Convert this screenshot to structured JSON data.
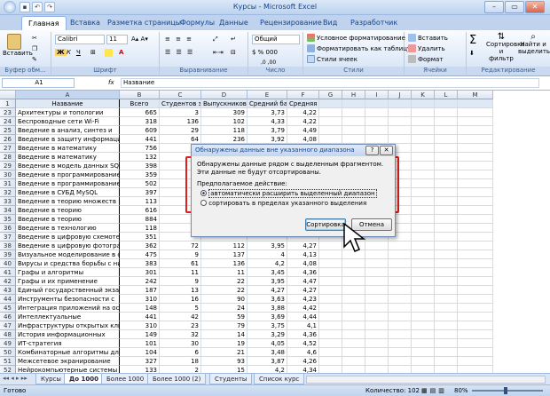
{
  "window": {
    "title": "Курсы - Microsoft Excel"
  },
  "tabs": [
    "Главная",
    "Вставка",
    "Разметка страницы",
    "Формулы",
    "Данные",
    "Рецензирование",
    "Вид",
    "Разработчик"
  ],
  "ribbon": {
    "paste": "Вставить",
    "clipboard": "Буфер обм...",
    "font_name": "Calibri",
    "font_size": "11",
    "font_group": "Шрифт",
    "align_group": "Выравнивание",
    "number_format": "Общий",
    "number_group": "Число",
    "cond_format": "Условное форматирование",
    "format_table": "Форматировать как таблицу",
    "cell_styles": "Стили ячеек",
    "styles_group": "Стили",
    "insert": "Вставить",
    "delete": "Удалить",
    "format": "Формат",
    "cells_group": "Ячейки",
    "sort_filter": "Сортировка и фильтр",
    "find_select": "Найти и выделить",
    "editing_group": "Редактирование"
  },
  "formula_bar": {
    "name_box": "A1",
    "fx": "fx",
    "value": "Название"
  },
  "columns": [
    "A",
    "B",
    "C",
    "D",
    "E",
    "F",
    "G",
    "H",
    "I",
    "J",
    "K",
    "L",
    "M"
  ],
  "header_row": {
    "num": "1",
    "a": "Название",
    "b": "Всего",
    "c": "Студентов за",
    "d": "Выпускников",
    "e": "Средний балл",
    "f": "Средняя"
  },
  "rows": [
    {
      "n": "23",
      "a": "Архитектуры и топологии",
      "b": "665",
      "c": "3",
      "d": "309",
      "e": "3,73",
      "f": "4,22"
    },
    {
      "n": "24",
      "a": "Беспроводные сети Wi-Fi",
      "b": "318",
      "c": "136",
      "d": "102",
      "e": "4,33",
      "f": "4,22"
    },
    {
      "n": "25",
      "a": "Введение в анализ, синтез и",
      "b": "609",
      "c": "29",
      "d": "118",
      "e": "3,79",
      "f": "4,49"
    },
    {
      "n": "26",
      "a": "Введение в защиту информации от",
      "b": "441",
      "c": "64",
      "d": "236",
      "e": "3,92",
      "f": "4,08"
    },
    {
      "n": "27",
      "a": "Введение в математику",
      "b": "756",
      "c": "",
      "d": "",
      "e": "",
      "f": ""
    },
    {
      "n": "28",
      "a": "Введение в математику",
      "b": "132",
      "c": "",
      "d": "",
      "e": "",
      "f": ""
    },
    {
      "n": "29",
      "a": "Введение в модель данных SQL",
      "b": "398",
      "c": "",
      "d": "",
      "e": "",
      "f": ""
    },
    {
      "n": "30",
      "a": "Введение в программирование на",
      "b": "359",
      "c": "",
      "d": "",
      "e": "",
      "f": ""
    },
    {
      "n": "31",
      "a": "Введение в программирование на",
      "b": "502",
      "c": "",
      "d": "",
      "e": "",
      "f": ""
    },
    {
      "n": "32",
      "a": "Введение в СУБД MySQL",
      "b": "397",
      "c": "",
      "d": "",
      "e": "",
      "f": ""
    },
    {
      "n": "33",
      "a": "Введение в теорию множеств",
      "b": "113",
      "c": "",
      "d": "",
      "e": "",
      "f": ""
    },
    {
      "n": "34",
      "a": "Введение в теорию",
      "b": "616",
      "c": "",
      "d": "",
      "e": "",
      "f": ""
    },
    {
      "n": "35",
      "a": "Введение в теорию",
      "b": "884",
      "c": "",
      "d": "",
      "e": "",
      "f": ""
    },
    {
      "n": "36",
      "a": "Введение в технологию",
      "b": "118",
      "c": "",
      "d": "",
      "e": "",
      "f": ""
    },
    {
      "n": "37",
      "a": "Введение в цифровую схемотехнику",
      "b": "351",
      "c": "",
      "d": "",
      "e": "",
      "f": ""
    },
    {
      "n": "38",
      "a": "Введение в цифровую фотографию",
      "b": "362",
      "c": "72",
      "d": "112",
      "e": "3,95",
      "f": "4,27"
    },
    {
      "n": "39",
      "a": "Визуальное моделирование в среде",
      "b": "475",
      "c": "9",
      "d": "137",
      "e": "4",
      "f": "4,13"
    },
    {
      "n": "40",
      "a": "Вирусы и средства борьбы с ними",
      "b": "383",
      "c": "61",
      "d": "136",
      "e": "4,2",
      "f": "4,08"
    },
    {
      "n": "41",
      "a": "Графы и алгоритмы",
      "b": "301",
      "c": "11",
      "d": "11",
      "e": "3,45",
      "f": "4,36"
    },
    {
      "n": "42",
      "a": "Графы и их применение",
      "b": "242",
      "c": "9",
      "d": "22",
      "e": "3,95",
      "f": "4,47"
    },
    {
      "n": "43",
      "a": "Единый государственный экзамен по",
      "b": "187",
      "c": "13",
      "d": "22",
      "e": "4,27",
      "f": "4,27"
    },
    {
      "n": "44",
      "a": "Инструменты безопасности с",
      "b": "310",
      "c": "16",
      "d": "90",
      "e": "3,63",
      "f": "4,23"
    },
    {
      "n": "45",
      "a": "Интеграция приложений на основе",
      "b": "148",
      "c": "5",
      "d": "24",
      "e": "3,88",
      "f": "4,42"
    },
    {
      "n": "46",
      "a": "Интеллектуальные",
      "b": "441",
      "c": "42",
      "d": "59",
      "e": "3,69",
      "f": "4,44"
    },
    {
      "n": "47",
      "a": "Инфраструктуры открытых ключей",
      "b": "310",
      "c": "23",
      "d": "79",
      "e": "3,75",
      "f": "4,1"
    },
    {
      "n": "48",
      "a": "История информационных",
      "b": "149",
      "c": "32",
      "d": "14",
      "e": "3,29",
      "f": "4,36"
    },
    {
      "n": "49",
      "a": "ИТ-стратегия",
      "b": "101",
      "c": "30",
      "d": "19",
      "e": "4,05",
      "f": "4,52"
    },
    {
      "n": "50",
      "a": "Комбинаторные алгоритмы для",
      "b": "104",
      "c": "6",
      "d": "21",
      "e": "3,48",
      "f": "4,6"
    },
    {
      "n": "51",
      "a": "Межсетевое экранирование",
      "b": "327",
      "c": "18",
      "d": "93",
      "e": "3,87",
      "f": "4,26"
    },
    {
      "n": "52",
      "a": "Нейрокомпьютерные системы",
      "b": "133",
      "c": "2",
      "d": "15",
      "e": "4,2",
      "f": "4,34"
    },
    {
      "n": "53",
      "a": "Организация UNIX-систем и ОС",
      "b": "469",
      "c": "23",
      "d": "136",
      "e": "3,64",
      "f": "4,32"
    }
  ],
  "dialog": {
    "title": "Обнаружены данные вне указанного диапазона",
    "help": "?",
    "close": "✕",
    "message": "Обнаружены данные рядом с выделенным фрагментом. Эти данные не будут отсортированы.",
    "prompt": "Предполагаемое действие:",
    "option1": "автоматически расширить выделенный диапазон",
    "option2": "сортировать в пределах указанного выделения",
    "ok": "Сортировка",
    "cancel": "Отмена"
  },
  "sheet_tabs": [
    "Курсы",
    "До 1000",
    "Более 1000",
    "Более 1000 (2)",
    "Студенты",
    "Список курс"
  ],
  "status": {
    "ready": "Готово",
    "count": "Количество: 102",
    "zoom": "80%"
  }
}
